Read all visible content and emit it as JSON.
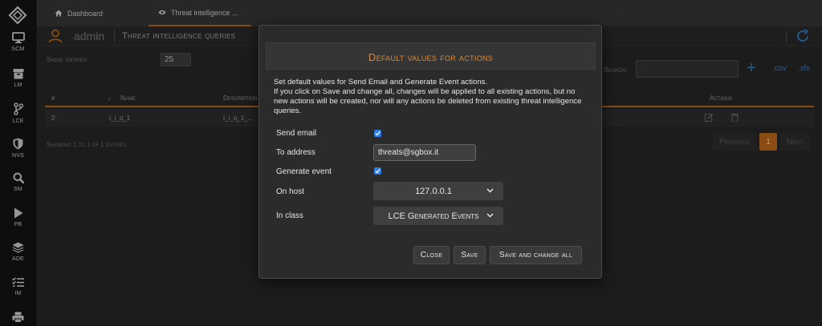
{
  "sidebar": {
    "items": [
      {
        "label": "SCM",
        "icon": "monitor-icon"
      },
      {
        "label": "LM",
        "icon": "archive-icon"
      },
      {
        "label": "LCE",
        "icon": "branch-icon"
      },
      {
        "label": "NVS",
        "icon": "shield-icon"
      },
      {
        "label": "SM",
        "icon": "search-icon"
      },
      {
        "label": "PB",
        "icon": "play-icon"
      },
      {
        "label": "ADE",
        "icon": "layers-icon"
      },
      {
        "label": "IM",
        "icon": "checklist-icon"
      },
      {
        "label": "",
        "icon": "printer-icon"
      }
    ]
  },
  "tabs": [
    {
      "label": "Dashboard",
      "icon": "home-icon"
    },
    {
      "label": "Threat intelligence ...",
      "icon": "eye-icon"
    }
  ],
  "header": {
    "user": "admin",
    "page_title": "Threat intelligence queries"
  },
  "table": {
    "show_label": "Show",
    "entries_value": "25",
    "entries_label": "entries",
    "search_label": "Search:",
    "add_label": "+",
    "csv_label": ".csv",
    "xls_label": ".xls",
    "columns": [
      "#",
      "Name",
      "Description",
      "Actions"
    ],
    "rows": [
      {
        "id": "2",
        "name": "t_i_q_1",
        "description": "t_i_q_1_..."
      }
    ],
    "info": "Showing 1 to 1 of 1 entries",
    "pager": {
      "prev": "Previous",
      "current": "1",
      "next": "Next"
    }
  },
  "modal": {
    "title": "Default values for actions",
    "description_line1": "Set default values for Send Email and Generate Event actions.",
    "description_line2": "If you click on Save and change all, changes will be applied to all existing actions, but no new actions will be created, nor will any actions be deleted from existing threat intelligence queries.",
    "fields": {
      "send_email_label": "Send email",
      "send_email_checked": true,
      "to_address_label": "To address",
      "to_address_value": "threats@sgbox.it",
      "generate_event_label": "Generate event",
      "generate_event_checked": true,
      "on_host_label": "On host",
      "on_host_value": "127.0.0.1",
      "in_class_label": "In class",
      "in_class_value": "LCE Generated Events"
    },
    "buttons": {
      "close": "Close",
      "save": "Save",
      "save_all": "Save and change all"
    }
  },
  "colors": {
    "accent": "#d4761c",
    "link": "#3b8fe0",
    "checkbox": "#2b7de9"
  }
}
